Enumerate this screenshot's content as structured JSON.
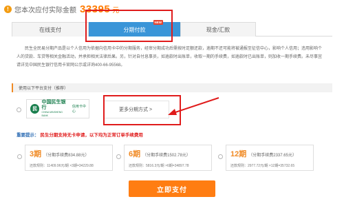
{
  "header": {
    "amount_label": "您本次应付实际金额",
    "amount": "33395",
    "unit": "元"
  },
  "tabs": [
    {
      "label": "在线支付"
    },
    {
      "label": "分期付款",
      "badge": "NEW"
    },
    {
      "label": "现金/汇款"
    }
  ],
  "description": "民生全民易分期产品是以个人信用为依据向信用卡中的分期服务，经审分期成功后需按时足额还款，逾期不还可能将被通报至征信中心，影响个人信用；违用影响个人的贷款、车贷等相关金融活动，并承担相关法律后果。另，针对自付息事员，如逾款时出账单，收取一期的手续费，如逾款时已出账单，则加收一期手续费。未尽事宜请详见中国民生银行信用卡官网公示或详询400-66-95568。",
  "section": {
    "title": "使用以下平台支付（推荐）"
  },
  "bank": {
    "name": "中国民生银行",
    "name_en": "CHINA MINSHENG BANK",
    "tag": "信用卡中心",
    "more_label": "更多分期方式 >"
  },
  "notice": {
    "label": "重要提示：",
    "text": "民生分期支持无卡申请，以下均为正常订单手续费用"
  },
  "plans": [
    {
      "periods": "3期",
      "fee": "（分期手续费834.88元）",
      "rule": "还款规则：11409.96元/期 ×3期=34229.88"
    },
    {
      "periods": "6期",
      "fee": "（分期手续费1502.78元）",
      "rule": "还款规则：5816.3元/期 ×6期=34897.78"
    },
    {
      "periods": "12期",
      "fee": "（分期手续费2337.65元）",
      "rule": "还款规则：2977.72元/期 ×12期=35732.65"
    }
  ],
  "pay_button": "立即支付",
  "colors": {
    "accent": "#ff7d12",
    "tab_active": "#3a95d8",
    "annotation": "#e01b1b",
    "bank_green": "#1a7f4e"
  }
}
